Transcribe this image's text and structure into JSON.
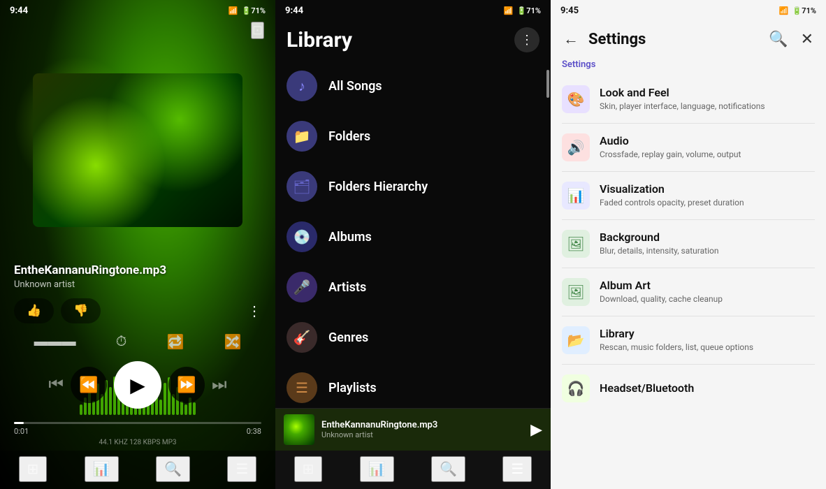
{
  "panel1": {
    "status_time": "9:44",
    "track_title": "EntheKannanuRingtone.mp3",
    "track_artist": "Unknown artist",
    "time_current": "0:01",
    "time_total": "0:38",
    "quality": "44.1 KHZ  128 KBPS  MP3",
    "progress_pct": 4,
    "like_icon": "👍",
    "dislike_icon": "👎",
    "more_icon": "⋮",
    "cast_icon": "⊡",
    "nav_items": [
      {
        "icon": "⊞",
        "label": "home",
        "active": false
      },
      {
        "icon": "⏶",
        "label": "stats",
        "active": false
      },
      {
        "icon": "🔍",
        "label": "search",
        "active": false
      },
      {
        "icon": "☰",
        "label": "menu",
        "active": false
      }
    ]
  },
  "panel2": {
    "status_time": "9:44",
    "title": "Library",
    "library_items": [
      {
        "id": "allsongs",
        "label": "All Songs",
        "icon": "♪",
        "icon_class": "lib-icon-allsongs"
      },
      {
        "id": "folders",
        "label": "Folders",
        "icon": "📁",
        "icon_class": "lib-icon-folders"
      },
      {
        "id": "hierarchy",
        "label": "Folders Hierarchy",
        "icon": "🗂",
        "icon_class": "lib-icon-hierarchy"
      },
      {
        "id": "albums",
        "label": "Albums",
        "icon": "💿",
        "icon_class": "lib-icon-albums"
      },
      {
        "id": "artists",
        "label": "Artists",
        "icon": "🎤",
        "icon_class": "lib-icon-artists"
      },
      {
        "id": "genres",
        "label": "Genres",
        "icon": "🎸",
        "icon_class": "lib-icon-genres"
      },
      {
        "id": "playlists",
        "label": "Playlists",
        "icon": "☰",
        "icon_class": "lib-icon-playlists"
      }
    ],
    "mini_title": "EntheKannanuRingtone.mp3",
    "mini_artist": "Unknown artist"
  },
  "panel3": {
    "status_time": "9:45",
    "title": "Settings",
    "breadcrumb": "Settings",
    "settings_items": [
      {
        "id": "look-feel",
        "title": "Look and Feel",
        "desc": "Skin, player interface, language, notifications",
        "icon": "🎨",
        "icon_class": "icon-look"
      },
      {
        "id": "audio",
        "title": "Audio",
        "desc": "Crossfade, replay gain, volume, output",
        "icon": "🔊",
        "icon_class": "icon-audio"
      },
      {
        "id": "visualization",
        "title": "Visualization",
        "desc": "Faded controls opacity, preset duration",
        "icon": "📊",
        "icon_class": "icon-viz"
      },
      {
        "id": "background",
        "title": "Background",
        "desc": "Blur, details, intensity, saturation",
        "icon": "🖼",
        "icon_class": "icon-bg"
      },
      {
        "id": "album-art",
        "title": "Album Art",
        "desc": "Download, quality, cache cleanup",
        "icon": "🖼",
        "icon_class": "icon-albumart"
      },
      {
        "id": "library",
        "title": "Library",
        "desc": "Rescan, music folders, list, queue options",
        "icon": "📂",
        "icon_class": "icon-library"
      },
      {
        "id": "headset",
        "title": "Headset/Bluetooth",
        "desc": "",
        "icon": "🎧",
        "icon_class": "icon-headset"
      }
    ]
  }
}
